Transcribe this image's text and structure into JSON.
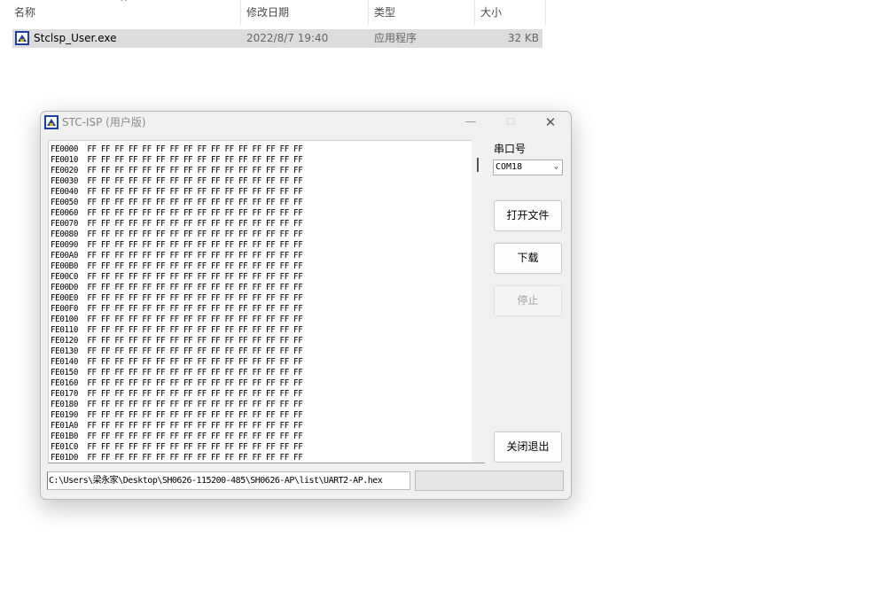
{
  "explorer": {
    "columns": [
      "名称",
      "修改日期",
      "类型",
      "大小"
    ],
    "sort_indicator": "^",
    "file": {
      "name": "Stclsp_User.exe",
      "modified": "2022/8/7 19:40",
      "type": "应用程序",
      "size": "32 KB"
    }
  },
  "window": {
    "title": "STC-ISP (用户版)",
    "controls": {
      "minimize": "—",
      "maximize": "☐",
      "close": "✕"
    },
    "hex_rows": [
      {
        "addr": "FE0000",
        "bytes": "FF FF FF FF FF FF FF FF FF FF FF FF FF FF FF FF"
      },
      {
        "addr": "FE0010",
        "bytes": "FF FF FF FF FF FF FF FF FF FF FF FF FF FF FF FF"
      },
      {
        "addr": "FE0020",
        "bytes": "FF FF FF FF FF FF FF FF FF FF FF FF FF FF FF FF"
      },
      {
        "addr": "FE0030",
        "bytes": "FF FF FF FF FF FF FF FF FF FF FF FF FF FF FF FF"
      },
      {
        "addr": "FE0040",
        "bytes": "FF FF FF FF FF FF FF FF FF FF FF FF FF FF FF FF"
      },
      {
        "addr": "FE0050",
        "bytes": "FF FF FF FF FF FF FF FF FF FF FF FF FF FF FF FF"
      },
      {
        "addr": "FE0060",
        "bytes": "FF FF FF FF FF FF FF FF FF FF FF FF FF FF FF FF"
      },
      {
        "addr": "FE0070",
        "bytes": "FF FF FF FF FF FF FF FF FF FF FF FF FF FF FF FF"
      },
      {
        "addr": "FE0080",
        "bytes": "FF FF FF FF FF FF FF FF FF FF FF FF FF FF FF FF"
      },
      {
        "addr": "FE0090",
        "bytes": "FF FF FF FF FF FF FF FF FF FF FF FF FF FF FF FF"
      },
      {
        "addr": "FE00A0",
        "bytes": "FF FF FF FF FF FF FF FF FF FF FF FF FF FF FF FF"
      },
      {
        "addr": "FE00B0",
        "bytes": "FF FF FF FF FF FF FF FF FF FF FF FF FF FF FF FF"
      },
      {
        "addr": "FE00C0",
        "bytes": "FF FF FF FF FF FF FF FF FF FF FF FF FF FF FF FF"
      },
      {
        "addr": "FE00D0",
        "bytes": "FF FF FF FF FF FF FF FF FF FF FF FF FF FF FF FF"
      },
      {
        "addr": "FE00E0",
        "bytes": "FF FF FF FF FF FF FF FF FF FF FF FF FF FF FF FF"
      },
      {
        "addr": "FE00F0",
        "bytes": "FF FF FF FF FF FF FF FF FF FF FF FF FF FF FF FF"
      },
      {
        "addr": "FE0100",
        "bytes": "FF FF FF FF FF FF FF FF FF FF FF FF FF FF FF FF"
      },
      {
        "addr": "FE0110",
        "bytes": "FF FF FF FF FF FF FF FF FF FF FF FF FF FF FF FF"
      },
      {
        "addr": "FE0120",
        "bytes": "FF FF FF FF FF FF FF FF FF FF FF FF FF FF FF FF"
      },
      {
        "addr": "FE0130",
        "bytes": "FF FF FF FF FF FF FF FF FF FF FF FF FF FF FF FF"
      },
      {
        "addr": "FE0140",
        "bytes": "FF FF FF FF FF FF FF FF FF FF FF FF FF FF FF FF"
      },
      {
        "addr": "FE0150",
        "bytes": "FF FF FF FF FF FF FF FF FF FF FF FF FF FF FF FF"
      },
      {
        "addr": "FE0160",
        "bytes": "FF FF FF FF FF FF FF FF FF FF FF FF FF FF FF FF"
      },
      {
        "addr": "FE0170",
        "bytes": "FF FF FF FF FF FF FF FF FF FF FF FF FF FF FF FF"
      },
      {
        "addr": "FE0180",
        "bytes": "FF FF FF FF FF FF FF FF FF FF FF FF FF FF FF FF"
      },
      {
        "addr": "FE0190",
        "bytes": "FF FF FF FF FF FF FF FF FF FF FF FF FF FF FF FF"
      },
      {
        "addr": "FE01A0",
        "bytes": "FF FF FF FF FF FF FF FF FF FF FF FF FF FF FF FF"
      },
      {
        "addr": "FE01B0",
        "bytes": "FF FF FF FF FF FF FF FF FF FF FF FF FF FF FF FF"
      },
      {
        "addr": "FE01C0",
        "bytes": "FF FF FF FF FF FF FF FF FF FF FF FF FF FF FF FF"
      },
      {
        "addr": "FE01D0",
        "bytes": "FF FF FF FF FF FF FF FF FF FF FF FF FF FF FF FF"
      }
    ],
    "port_label": "串口号",
    "port_value": "COM18",
    "buttons": {
      "open": "打开文件",
      "download": "下载",
      "stop": "停止",
      "exit": "关闭退出"
    },
    "file_path": "C:\\Users\\梁永家\\Desktop\\SH0626-115200-485\\SH0626-AP\\list\\UART2-AP.hex",
    "progress": 0
  },
  "colors": {
    "selection": "#dcdcdc",
    "window_bg": "#f0f0f0",
    "progress_fill": "#06b025"
  },
  "icons": [
    "stc-isp-app-icon",
    "chevron-down-icon",
    "minimize-icon",
    "maximize-icon",
    "close-icon"
  ]
}
